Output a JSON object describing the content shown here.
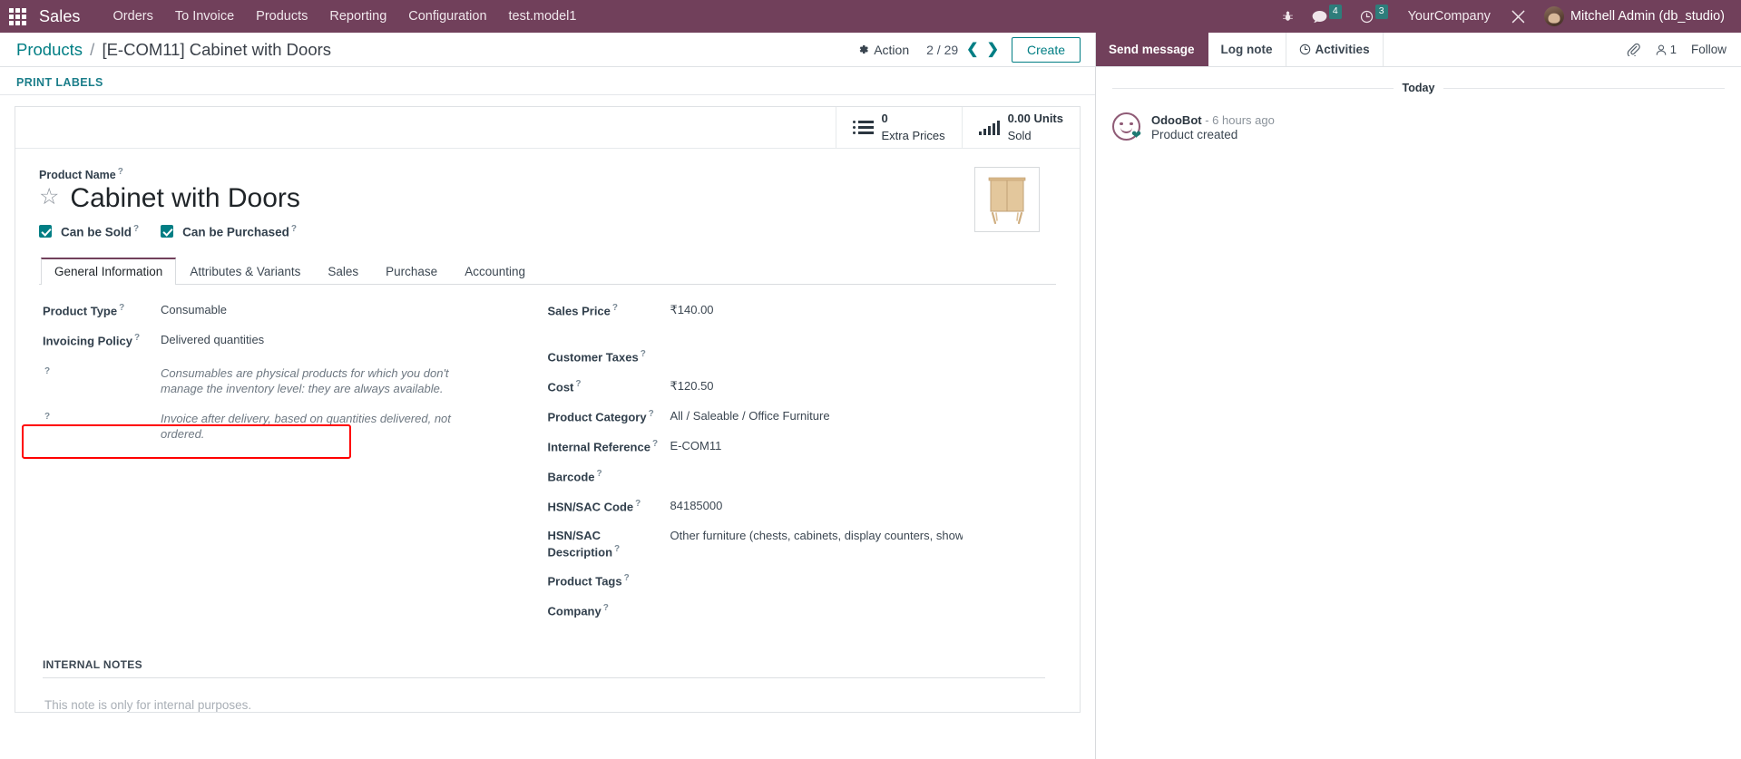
{
  "navbar": {
    "apps_icon": "apps-grid-icon",
    "brand": "Sales",
    "menu": [
      "Orders",
      "To Invoice",
      "Products",
      "Reporting",
      "Configuration",
      "test.model1"
    ],
    "right": {
      "bug_icon": "bug-icon",
      "messages_icon": "chat-bubble-icon",
      "messages_count": "4",
      "activities_icon": "clock-icon",
      "activities_count": "3",
      "company": "YourCompany",
      "tools_icon": "wrench-screwdriver-icon",
      "user": "Mitchell Admin (db_studio)"
    },
    "accent": "#71405B"
  },
  "control_panel": {
    "breadcrumb_root": "Products",
    "breadcrumb_sep": "/",
    "breadcrumb_current": "[E-COM11] Cabinet with Doors",
    "action_label": "Action",
    "action_icon": "gear-icon",
    "pager": "2 / 29",
    "prev_icon": "chevron-left-icon",
    "next_icon": "chevron-right-icon",
    "create_label": "Create"
  },
  "button_bar": {
    "print_labels": "PRINT LABELS"
  },
  "stat_buttons": [
    {
      "icon": "list-icon",
      "value": "0",
      "label": "Extra Prices"
    },
    {
      "icon": "bar-chart-icon",
      "value": "0.00 Units",
      "label": "Sold"
    }
  ],
  "product": {
    "name_label": "Product Name",
    "name": "Cabinet with Doors",
    "star_icon": "star-outline-icon",
    "image_icon": "cabinet-with-doors-photo",
    "checkboxes": [
      {
        "label": "Can be Sold",
        "checked": true
      },
      {
        "label": "Can be Purchased",
        "checked": true
      }
    ]
  },
  "tabs": [
    {
      "label": "General Information",
      "active": true
    },
    {
      "label": "Attributes & Variants",
      "active": false
    },
    {
      "label": "Sales",
      "active": false
    },
    {
      "label": "Purchase",
      "active": false
    },
    {
      "label": "Accounting",
      "active": false
    }
  ],
  "general_information": {
    "left_fields": [
      {
        "label": "Product Type",
        "value": "Consumable",
        "highlighted": true
      },
      {
        "label": "Invoicing Policy",
        "value": "Delivered quantities",
        "highlighted": false
      }
    ],
    "left_help": [
      "Consumables are physical products for which you don't manage the inventory level: they are always available.",
      "Invoice after delivery, based on quantities delivered, not ordered."
    ],
    "right_fields": [
      {
        "label": "Sales Price",
        "value": "₹140.00"
      },
      {
        "label": "Customer Taxes",
        "value": ""
      },
      {
        "label": "Cost",
        "value": "₹120.50"
      },
      {
        "label": "Product Category",
        "value": "All / Saleable / Office Furniture"
      },
      {
        "label": "Internal Reference",
        "value": "E-COM11"
      },
      {
        "label": "Barcode",
        "value": ""
      },
      {
        "label": "HSN/SAC Code",
        "value": "84185000"
      },
      {
        "label": "HSN/SAC Description",
        "value": "Other furniture (chests, cabinets, display counters, show-cases an"
      },
      {
        "label": "Product Tags",
        "value": ""
      },
      {
        "label": "Company",
        "value": ""
      }
    ],
    "highlight_color": "#ff0000"
  },
  "internal_notes": {
    "heading": "INTERNAL NOTES",
    "placeholder": "This note is only for internal purposes."
  },
  "chatter": {
    "send_message": "Send message",
    "log_note": "Log note",
    "activities": "Activities",
    "activities_icon": "clock-icon",
    "attachment_icon": "paperclip-icon",
    "followers_icon": "user-icon",
    "followers_count": "1",
    "follow_label": "Follow",
    "day_separator": "Today",
    "messages": [
      {
        "avatar": "odoobot-avatar",
        "author": "OdooBot",
        "time": "- 6 hours ago",
        "body": "Product created"
      }
    ]
  }
}
